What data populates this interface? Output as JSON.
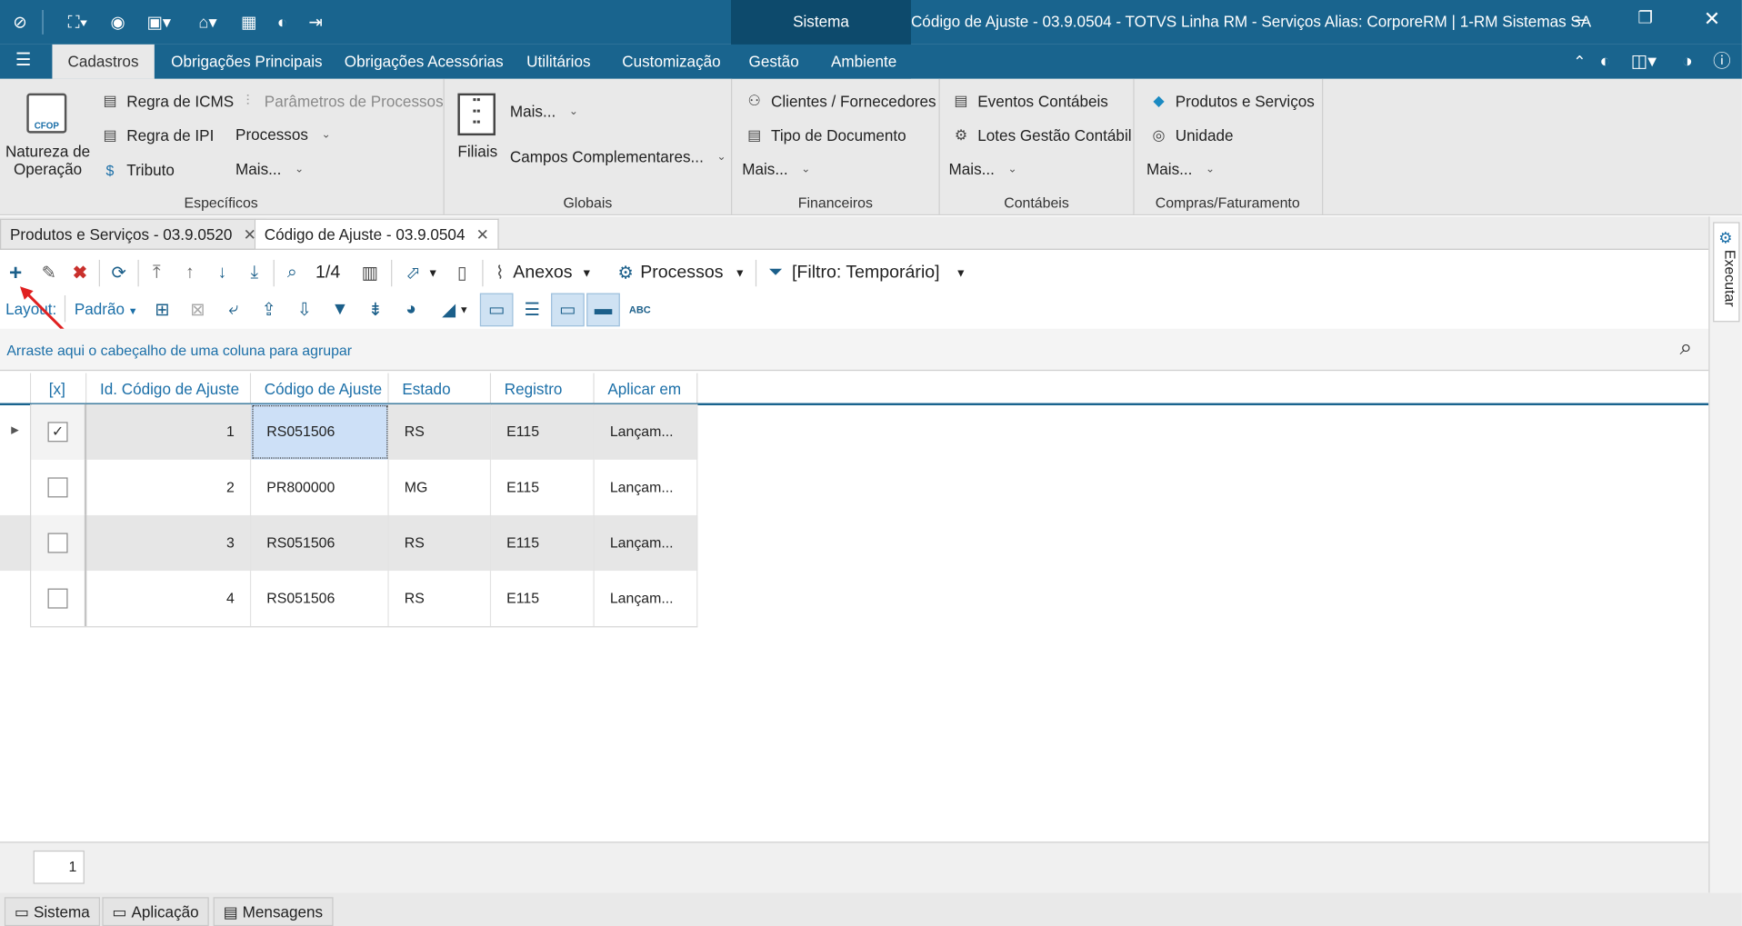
{
  "titlebar": {
    "system_tab": "Sistema",
    "title": "Código de Ajuste - 03.9.0504 - TOTVS Linha RM - Serviços  Alias: CorporeRM | 1-RM Sistemas SA"
  },
  "menu": {
    "tabs": [
      "Cadastros",
      "Obrigações Principais",
      "Obrigações Acessórias",
      "Utilitários",
      "Customização",
      "Gestão",
      "Ambiente"
    ]
  },
  "ribbon": {
    "natureza": "Natureza de Operação",
    "natureza_l1": "Natureza de",
    "natureza_l2": "Operação",
    "cfop_badge": "CFOP",
    "regra_icms": "Regra de ICMS",
    "parametros": "Parâmetros de Processos",
    "regra_ipi": "Regra de IPI",
    "processos": "Processos",
    "tributo": "Tributo",
    "mais": "Mais...",
    "filiais": "Filiais",
    "campos": "Campos Complementares...",
    "clientes": "Clientes / Fornecedores",
    "tipo_doc": "Tipo de Documento",
    "eventos": "Eventos Contábeis",
    "lotes": "Lotes Gestão Contábil",
    "produtos": "Produtos e Serviços",
    "unidade": "Unidade",
    "groups": [
      "Específicos",
      "Globais",
      "Financeiros",
      "Contábeis",
      "Compras/Faturamento"
    ]
  },
  "doctabs": [
    "Produtos e Serviços - 03.9.0520",
    "Código de Ajuste - 03.9.0504"
  ],
  "toolbar": {
    "record_counter": "1/4",
    "anexos": "Anexos",
    "processos": "Processos",
    "filter": "[Filtro: Temporário]",
    "layout_label": "Layout:",
    "layout_value": "Padrão",
    "abc": "ABC"
  },
  "grid": {
    "group_hint": "Arraste aqui o cabeçalho de uma coluna para agrupar",
    "columns": [
      "[x]",
      "Id. Código de Ajuste",
      "Código de Ajuste",
      "Estado",
      "Registro",
      "Aplicar em"
    ],
    "rows": [
      {
        "checked": true,
        "id": "1",
        "codigo": "RS051506",
        "estado": "RS",
        "registro": "E115",
        "aplicar": "Lançam..."
      },
      {
        "checked": false,
        "id": "2",
        "codigo": "PR800000",
        "estado": "MG",
        "registro": "E115",
        "aplicar": "Lançam..."
      },
      {
        "checked": false,
        "id": "3",
        "codigo": "RS051506",
        "estado": "RS",
        "registro": "E115",
        "aplicar": "Lançam..."
      },
      {
        "checked": false,
        "id": "4",
        "codigo": "RS051506",
        "estado": "RS",
        "registro": "E115",
        "aplicar": "Lançam..."
      }
    ],
    "check_mark": "✓"
  },
  "footer": {
    "page": "1"
  },
  "statusbar": [
    "Sistema",
    "Aplicação",
    "Mensagens"
  ],
  "side_panel": {
    "label": "Executar"
  },
  "colors": {
    "brand": "#19648e",
    "dark_brand": "#0d4a6c",
    "ribbon_bg": "#e9e9e9",
    "selected_cell": "#cde0f7",
    "link": "#1b6fa8"
  }
}
